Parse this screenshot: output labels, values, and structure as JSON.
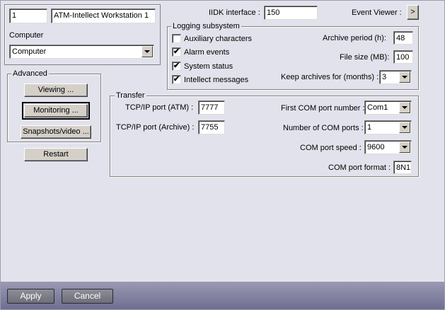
{
  "computer": {
    "id": "1",
    "name": "ATM-Intellect Workstation 1",
    "label": "Computer",
    "selected": "Computer"
  },
  "iidk": {
    "label": "IIDK interface :",
    "value": "150"
  },
  "event_viewer": {
    "label": "Event Viewer :",
    "button": ">"
  },
  "logging": {
    "title": "Logging subsystem",
    "checkboxes": [
      {
        "label": "Auxiliary characters",
        "checked": false
      },
      {
        "label": "Alarm events",
        "checked": true
      },
      {
        "label": "System status",
        "checked": true
      },
      {
        "label": "Intellect messages",
        "checked": true
      }
    ],
    "archive_period_label": "Archive period (h):",
    "archive_period": "48",
    "file_size_label": "File size (MB):",
    "file_size": "100",
    "keep_archives_label": "Keep archives for (months) :",
    "keep_archives": "3"
  },
  "advanced": {
    "title": "Advanced",
    "viewing": "Viewing ...",
    "monitoring": "Monitoring ...",
    "snapshots": "Snapshots/video ..."
  },
  "restart": "Restart",
  "transfer": {
    "title": "Transfer",
    "tcp_atm_label": "TCP/IP port (ATM) :",
    "tcp_atm": "7777",
    "tcp_archive_label": "TCP/IP port (Archive) :",
    "tcp_archive": "7755",
    "first_com_label": "First COM port number :",
    "first_com": "Com1",
    "num_com_label": "Number of COM ports :",
    "num_com": "1",
    "com_speed_label": "COM port speed :",
    "com_speed": "9600",
    "com_format_label": "COM port format :",
    "com_format": "8N1"
  },
  "footer": {
    "apply": "Apply",
    "cancel": "Cancel"
  },
  "icons": {
    "check": "✔",
    "dropdown": "chevron-down-icon"
  }
}
